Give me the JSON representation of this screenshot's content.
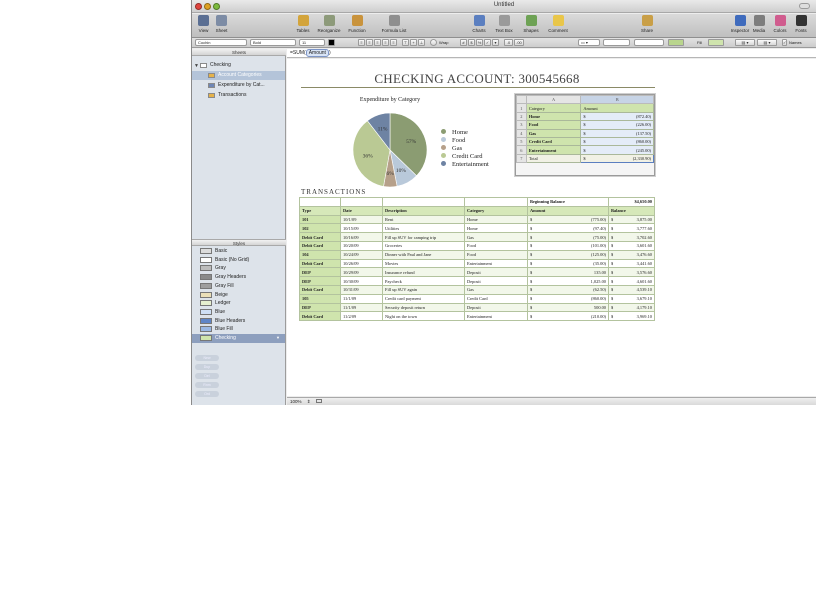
{
  "window": {
    "title": "Untitled"
  },
  "toolbar": {
    "items": [
      {
        "label": "View",
        "icon": "view-icon"
      },
      {
        "label": "Sheet",
        "icon": "sheet-icon"
      },
      {
        "label": "Tables",
        "icon": "tables-icon"
      },
      {
        "label": "Reorganize",
        "icon": "reorganize-icon"
      },
      {
        "label": "Function",
        "icon": "function-icon"
      },
      {
        "label": "Formula List",
        "icon": "formula-list-icon"
      },
      {
        "label": "Charts",
        "icon": "charts-icon"
      },
      {
        "label": "Text Box",
        "icon": "text-box-icon"
      },
      {
        "label": "Shapes",
        "icon": "shapes-icon"
      },
      {
        "label": "Comment",
        "icon": "comment-icon"
      },
      {
        "label": "Share",
        "icon": "share-icon"
      },
      {
        "label": "Inspector",
        "icon": "inspector-icon"
      },
      {
        "label": "Media",
        "icon": "media-icon"
      },
      {
        "label": "Colors",
        "icon": "colors-icon"
      },
      {
        "label": "Fonts",
        "icon": "fonts-icon"
      }
    ]
  },
  "formatbar": {
    "font": "Cochin",
    "style": "Bold",
    "size": "11",
    "wrap": "Wrap",
    "fill": "Fill",
    "names": "Names",
    "currency": "$",
    "percent": "%",
    "decimals_less": ".0",
    "decimals_more": ".00"
  },
  "sidebar": {
    "sheets_header": "Sheets",
    "sheets": [
      {
        "label": "Checking",
        "kind": "sheet"
      },
      {
        "label": "Account Categories",
        "kind": "table",
        "selected": true
      },
      {
        "label": "Expenditure by Cat...",
        "kind": "chart"
      },
      {
        "label": "Transactions",
        "kind": "table"
      }
    ],
    "styles_header": "Styles",
    "styles": [
      {
        "label": "Basic",
        "color": "#dcdcdc"
      },
      {
        "label": "Basic (No Grid)",
        "color": "#ffffff"
      },
      {
        "label": "Gray",
        "color": "#bdbdbd"
      },
      {
        "label": "Gray Headers",
        "color": "#8a8a8a"
      },
      {
        "label": "Gray Fill",
        "color": "#9e9e9e"
      },
      {
        "label": "Beige",
        "color": "#eadfb8"
      },
      {
        "label": "Ledger",
        "color": "#e5efcf"
      },
      {
        "label": "Blue",
        "color": "#cfe0f5"
      },
      {
        "label": "Blue Headers",
        "color": "#5f86c8"
      },
      {
        "label": "Blue Fill",
        "color": "#9ab8e4"
      },
      {
        "label": "Checking",
        "color": "#cfe4ad",
        "selected": true
      }
    ],
    "ghost_buttons": [
      "New",
      "Dup",
      "Del",
      "Rnm",
      "Ord"
    ]
  },
  "formula": {
    "prefix": "=SUM(",
    "token": "Amount",
    "suffix": ")"
  },
  "status": {
    "zoom": "100%"
  },
  "sheet": {
    "title": "CHECKING ACCOUNT: 300545668",
    "transactions_title": "TRANSACTIONS"
  },
  "chart_data": {
    "type": "pie",
    "title": "Expenditure by Category",
    "series": [
      {
        "name": "Home",
        "value": 872.4,
        "label": "57%",
        "color": "#8b9c72"
      },
      {
        "name": "Food",
        "value": 226.0,
        "label": "10%",
        "color": "#b9c9da"
      },
      {
        "name": "Gas",
        "value": 137.5,
        "label": "6%",
        "color": "#b6a08a"
      },
      {
        "name": "Credit Card",
        "value": 860.0,
        "label": "36%",
        "color": "#bac994"
      },
      {
        "name": "Entertainment",
        "value": 245.0,
        "label": "11%",
        "color": "#6e83a3"
      }
    ]
  },
  "category_table": {
    "col_letters": [
      "A",
      "B"
    ],
    "headers": [
      "Category",
      "Amount"
    ],
    "rows": [
      {
        "n": "2",
        "category": "Home",
        "amount": "(872.40)"
      },
      {
        "n": "3",
        "category": "Food",
        "amount": "(226.00)"
      },
      {
        "n": "4",
        "category": "Gas",
        "amount": "(137.50)"
      },
      {
        "n": "5",
        "category": "Credit Card",
        "amount": "(860.00)"
      },
      {
        "n": "6",
        "category": "Entertainment",
        "amount": "(245.00)"
      }
    ],
    "total": {
      "n": "7",
      "label": "Total",
      "amount": "(2,330.90)"
    },
    "currency": "$"
  },
  "transactions": {
    "beginning_label": "Beginning Balance",
    "beginning_value": "$4,650.00",
    "headers": [
      "Type",
      "Date",
      "Description",
      "Category",
      "Amount",
      "Balance"
    ],
    "rows": [
      {
        "type": "101",
        "date": "10/1/09",
        "desc": "Rent",
        "cat": "Home",
        "amt": "(775.00)",
        "bal": "3,875.00"
      },
      {
        "type": "102",
        "date": "10/15/09",
        "desc": "Utilities",
        "cat": "Home",
        "amt": "(97.40)",
        "bal": "3,777.60"
      },
      {
        "type": "Debit Card",
        "date": "10/16/09",
        "desc": "Fill up SUV for camping trip",
        "cat": "Gas",
        "amt": "(75.00)",
        "bal": "3,702.60"
      },
      {
        "type": "Debit Card",
        "date": "10/20/09",
        "desc": "Groceries",
        "cat": "Food",
        "amt": "(101.00)",
        "bal": "3,601.60"
      },
      {
        "type": "104",
        "date": "10/24/09",
        "desc": "Dinner with Paul and Jane",
        "cat": "Food",
        "amt": "(125.00)",
        "bal": "3,476.60"
      },
      {
        "type": "Debit Card",
        "date": "10/26/09",
        "desc": "Movies",
        "cat": "Entertainment",
        "amt": "(35.00)",
        "bal": "3,441.60"
      },
      {
        "type": "DEP",
        "date": "10/29/09",
        "desc": "Insurance refund",
        "cat": "Deposit",
        "amt": "135.00",
        "bal": "3,576.60"
      },
      {
        "type": "DEP",
        "date": "10/30/09",
        "desc": "Paycheck",
        "cat": "Deposit",
        "amt": "1,025.00",
        "bal": "4,601.60"
      },
      {
        "type": "Debit Card",
        "date": "10/31/09",
        "desc": "Fill up SUV again",
        "cat": "Gas",
        "amt": "(62.50)",
        "bal": "4,539.10"
      },
      {
        "type": "105",
        "date": "11/1/09",
        "desc": "Credit card payment",
        "cat": "Credit Card",
        "amt": "(860.00)",
        "bal": "3,679.10"
      },
      {
        "type": "DEP",
        "date": "11/1/09",
        "desc": "Security deposit return",
        "cat": "Deposit",
        "amt": "500.00",
        "bal": "4,179.10"
      },
      {
        "type": "Debit Card",
        "date": "11/2/09",
        "desc": "Night on the town",
        "cat": "Entertainment",
        "amt": "(210.00)",
        "bal": "3,969.10"
      }
    ],
    "currency": "$"
  }
}
